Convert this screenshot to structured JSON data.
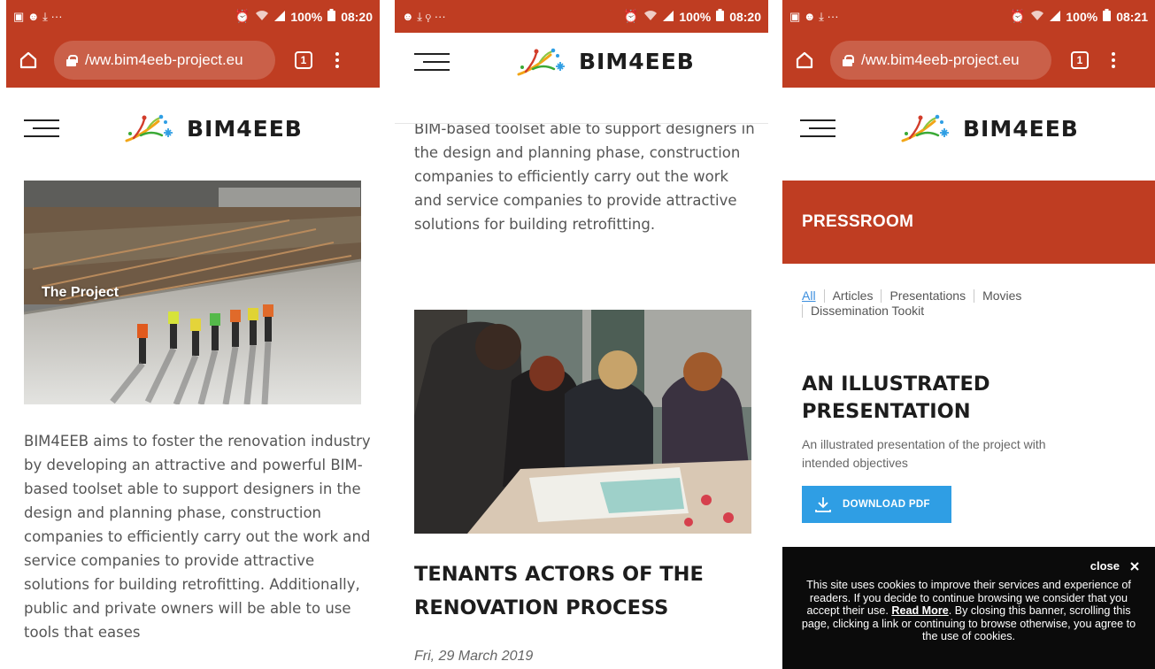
{
  "status_bars": [
    {
      "left": "▣ ☻ ⤓ ···",
      "battery": "100%",
      "time": "08:20"
    },
    {
      "left": "☻ ⤓ ⚲ ···",
      "battery": "100%",
      "time": "08:20"
    },
    {
      "left": "▣ ☻ ⤓ ···",
      "battery": "100%",
      "time": "08:21"
    }
  ],
  "browser": {
    "url": "/ww.bim4eeb-project.eu",
    "tab_count": "1"
  },
  "logo": {
    "text": "BIM4EEB"
  },
  "panel1": {
    "hero_label": "The Project",
    "body": "BIM4EEB aims to foster the renovation industry by developing an attractive and powerful BIM-based toolset able to support designers in the design and planning phase, construction companies to efficiently carry out the work and service companies to provide attractive solutions for building retrofitting. Additionally, public and private owners will be able to use  tools that eases"
  },
  "panel2": {
    "body": "BIM-based toolset able to support designers in the design and planning phase, construction companies to efficiently carry out the work and service companies to provide attractive solutions for building retrofitting.",
    "article_title": "TENANTS ACTORS OF THE RENOVATION PROCESS",
    "article_date": "Fri, 29 March 2019"
  },
  "panel3": {
    "section_title": "PRESSROOM",
    "filters": [
      "All",
      "Articles",
      "Presentations",
      "Movies",
      "Dissemination Tookit"
    ],
    "presentation_title": "AN ILLUSTRATED PRESENTATION",
    "presentation_desc": "An illustrated presentation of the project with intended objectives",
    "download_label": "DOWNLOAD PDF",
    "cookie": {
      "close_label": "close",
      "text_before": "This site uses cookies to improve their services and experience of readers. If you decide to continue browsing we consider that you accept their use.",
      "read_more": "Read More",
      "text_after": ". By closing this banner, scrolling this page, clicking a link or continuing to browse otherwise, you agree to the use of cookies."
    }
  },
  "colors": {
    "brand_red": "#bf3d22",
    "link_blue": "#3b8ede",
    "button_blue": "#2f9ee4",
    "cookie_bg": "#0b0b0b"
  },
  "icons": [
    "home-icon",
    "lock-icon",
    "tabs-icon",
    "more-vert-icon",
    "hamburger-icon",
    "logo-tree-icon",
    "download-icon",
    "close-icon",
    "alarm-icon",
    "wifi-icon",
    "signal-icon",
    "battery-icon"
  ]
}
